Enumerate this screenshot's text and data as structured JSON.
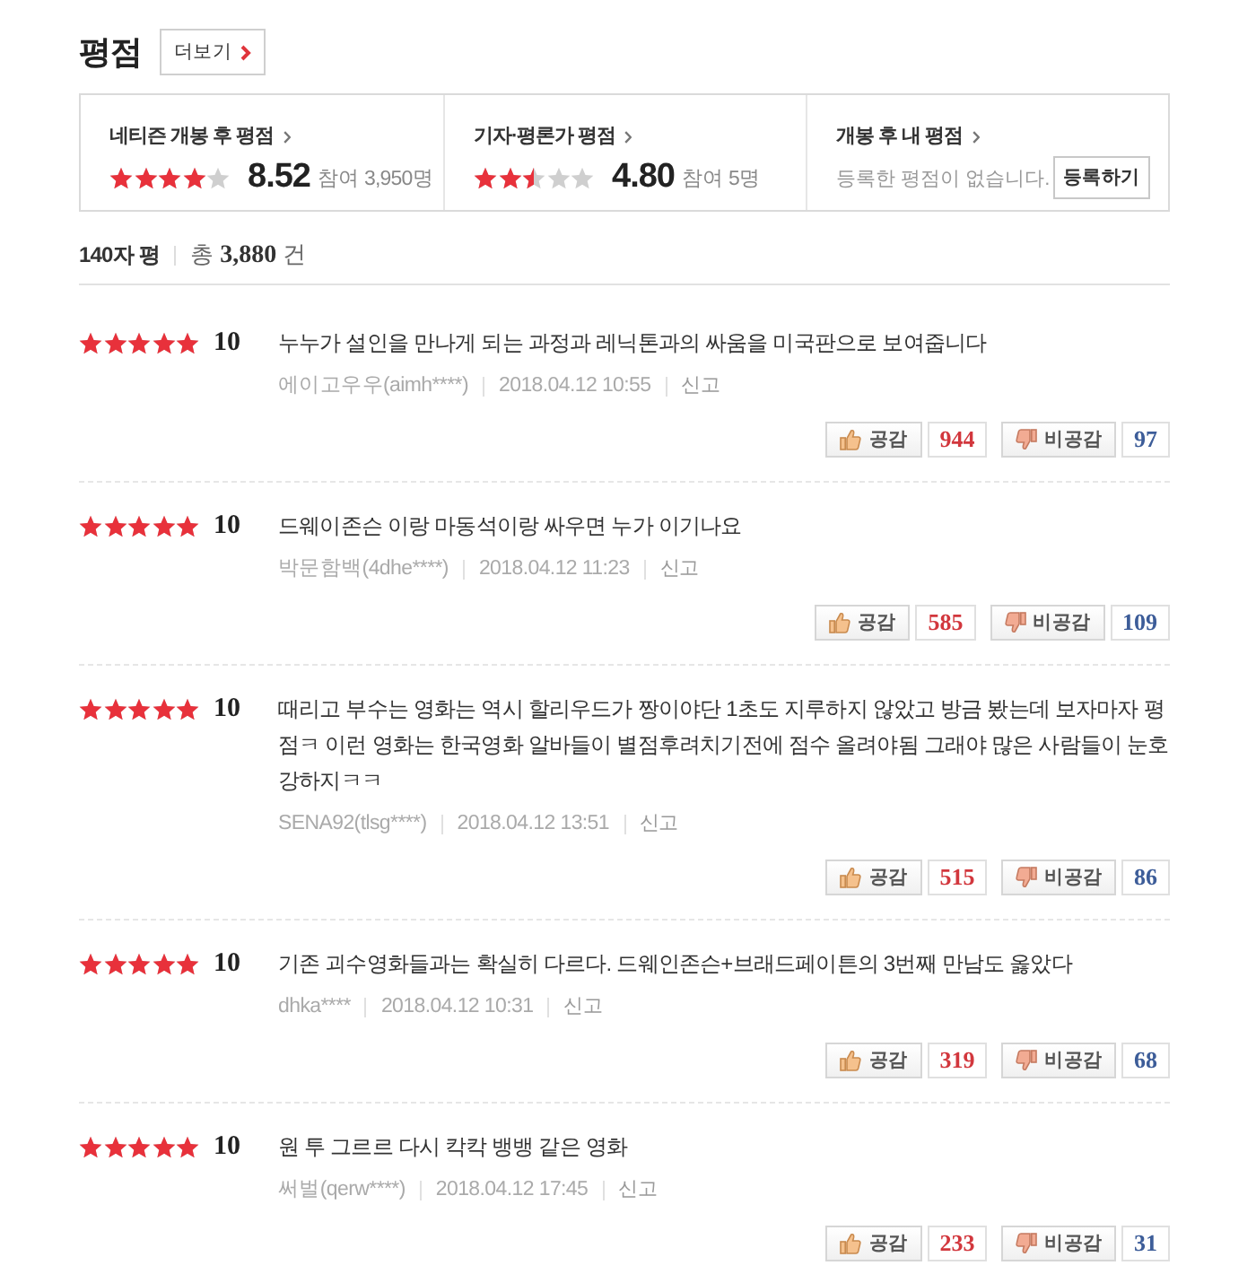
{
  "header": {
    "title": "평점",
    "more_button": "더보기"
  },
  "summary": [
    {
      "kind": "score",
      "title": "네티즌 개봉 후 평점",
      "stars": 4,
      "score": "8.52",
      "participants": "참여 3,950명"
    },
    {
      "kind": "score",
      "title": "기자·평론가 평점",
      "stars": 2.5,
      "score": "4.80",
      "participants": "참여 5명"
    },
    {
      "kind": "mine",
      "title": "개봉 후 내 평점",
      "message": "등록한 평점이 없습니다.",
      "button": "등록하기"
    }
  ],
  "count_bar": {
    "label": "140자 평",
    "total": "총 **3,880** 건"
  },
  "reviews": [
    {
      "stars": 5,
      "score": "10",
      "text": "누누가 설인을 만나게 되는 과정과 레닉톤과의 싸움을 미국판으로 보여줍니다",
      "author": "에이고우우(aimh****)",
      "date": "2018.04.12 10:55",
      "report": "신고",
      "like_label": "공감",
      "likes": "944",
      "dislike_label": "비공감",
      "dislikes": "97"
    },
    {
      "stars": 5,
      "score": "10",
      "text": "드웨이존슨 이랑 마동석이랑 싸우면 누가 이기나요",
      "author": "박문함백(4dhe****)",
      "date": "2018.04.12 11:23",
      "report": "신고",
      "like_label": "공감",
      "likes": "585",
      "dislike_label": "비공감",
      "dislikes": "109"
    },
    {
      "stars": 5,
      "score": "10",
      "text": "때리고 부수는 영화는 역시 할리우드가 짱이야단 1초도 지루하지 않았고 방금 봤는데 보자마자 평점ㅋ 이런 영화는 한국영화 알바들이 별점후려치기전에 점수 올려야됨 그래야 많은 사람들이 눈호강하지ㅋㅋ",
      "author": "SENA92(tlsg****)",
      "date": "2018.04.12 13:51",
      "report": "신고",
      "like_label": "공감",
      "likes": "515",
      "dislike_label": "비공감",
      "dislikes": "86"
    },
    {
      "stars": 5,
      "score": "10",
      "text": "기존 괴수영화들과는 확실히 다르다. 드웨인존슨+브래드페이튼의 3번째 만남도 옳았다",
      "author": "dhka****",
      "date": "2018.04.12 10:31",
      "report": "신고",
      "like_label": "공감",
      "likes": "319",
      "dislike_label": "비공감",
      "dislikes": "68"
    },
    {
      "stars": 5,
      "score": "10",
      "text": "원 투 그르르 다시 칵칵 뱅뱅 같은 영화",
      "author": "써벌(qerw****)",
      "date": "2018.04.12 17:45",
      "report": "신고",
      "like_label": "공감",
      "likes": "233",
      "dislike_label": "비공감",
      "dislikes": "31"
    }
  ]
}
